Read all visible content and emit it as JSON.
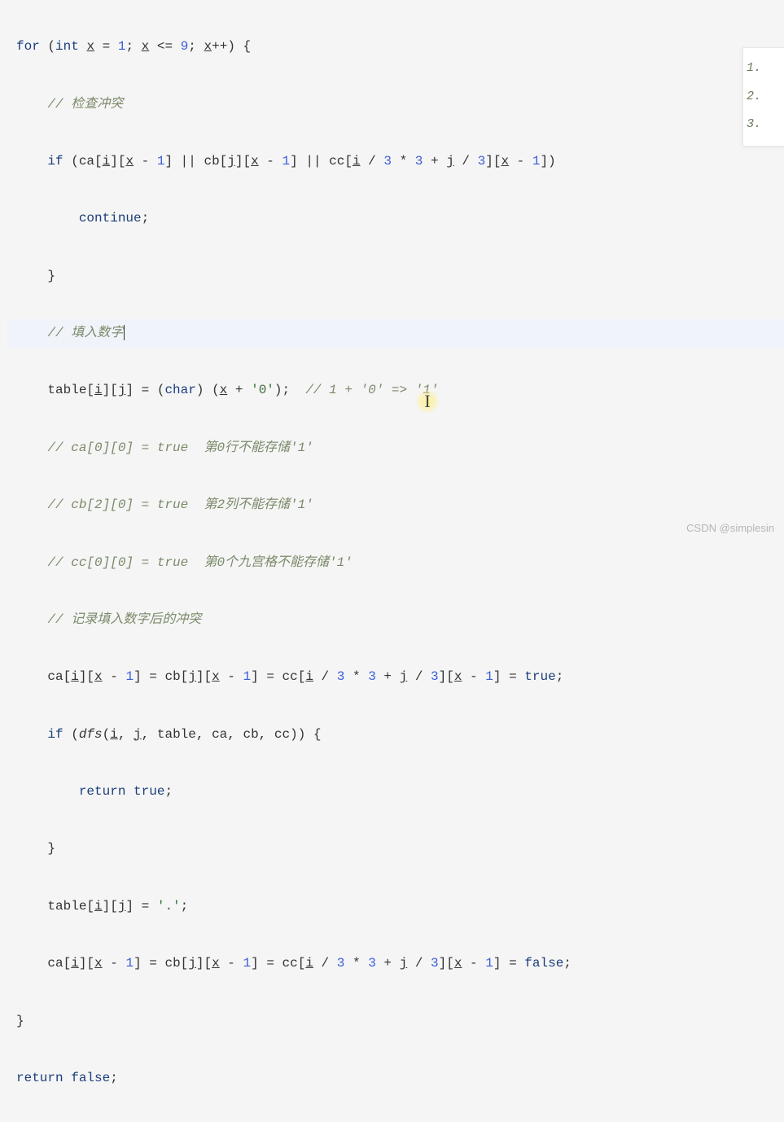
{
  "code": {
    "l1_for": "for",
    "l1_int": "int",
    "l1_x1": "x",
    "l1_eq": " = ",
    "l1_one": "1",
    "l1_sc1": "; ",
    "l1_x2": "x",
    "l1_le": " <= ",
    "l1_nine": "9",
    "l1_sc2": "; ",
    "l1_x3": "x",
    "l1_inc": "++) {",
    "l2_comment": "// 检查冲突",
    "l3_if": "if",
    "l3_a": " (ca[",
    "l3_i1": "i",
    "l3_b": "][",
    "l3_x1": "x",
    "l3_c": " - ",
    "l3_one1": "1",
    "l3_d": "] || cb[",
    "l3_j1": "j",
    "l3_e": "][",
    "l3_x2": "x",
    "l3_f": " - ",
    "l3_one2": "1",
    "l3_g": "] || cc[",
    "l3_i2": "i",
    "l3_h": " / ",
    "l3_three1": "3",
    "l3_i3": " * ",
    "l3_three2": "3",
    "l3_j2": " + ",
    "l3_jvar": "j",
    "l3_k": " / ",
    "l3_three3": "3",
    "l3_l": "][",
    "l3_x3": "x",
    "l3_m": " - ",
    "l3_one3": "1",
    "l3_n": "])",
    "l4_continue": "continue",
    "l4_sc": ";",
    "l5_close": "}",
    "l6_comment": "// 填入数字",
    "l7_a": "table[",
    "l7_i": "i",
    "l7_b": "][",
    "l7_j": "j",
    "l7_c": "] = (",
    "l7_char": "char",
    "l7_d": ") (",
    "l7_x": "x",
    "l7_e": " + ",
    "l7_zero": "'0'",
    "l7_f": ");  ",
    "l7_comment": "// 1 + '0' => '1'",
    "l8_comment": "// ca[0][0] = true  第0行不能存储'1'",
    "l9_comment": "// cb[2][0] = true  第2列不能存储'1'",
    "l10_comment": "// cc[0][0] = true  第0个九宫格不能存储'1'",
    "l11_comment": "// 记录填入数字后的冲突",
    "l12_a": "ca[",
    "l12_i1": "i",
    "l12_b": "][",
    "l12_x1": "x",
    "l12_c": " - ",
    "l12_one1": "1",
    "l12_d": "] = cb[",
    "l12_j1": "j",
    "l12_e": "][",
    "l12_x2": "x",
    "l12_f": " - ",
    "l12_one2": "1",
    "l12_g": "] = cc[",
    "l12_i2": "i",
    "l12_h": " / ",
    "l12_three1": "3",
    "l12_i3": " * ",
    "l12_three2": "3",
    "l12_j2": " + ",
    "l12_jvar": "j",
    "l12_k": " / ",
    "l12_three3": "3",
    "l12_l": "][",
    "l12_x3": "x",
    "l12_m": " - ",
    "l12_one3": "1",
    "l12_n": "] = ",
    "l12_true": "true",
    "l12_sc": ";",
    "l13_if": "if",
    "l13_a": " (",
    "l13_dfs": "dfs",
    "l13_b": "(",
    "l13_i": "i",
    "l13_c": ", ",
    "l13_j": "j",
    "l13_d": ", table, ca, cb, cc)) {",
    "l14_return": "return",
    "l14_sp": " ",
    "l14_true": "true",
    "l14_sc": ";",
    "l15_close": "}",
    "l16_a": "table[",
    "l16_i": "i",
    "l16_b": "][",
    "l16_j": "j",
    "l16_c": "] = ",
    "l16_dot": "'.'",
    "l16_sc": ";",
    "l17_a": "ca[",
    "l17_i1": "i",
    "l17_b": "][",
    "l17_x1": "x",
    "l17_c": " - ",
    "l17_one1": "1",
    "l17_d": "] = cb[",
    "l17_j1": "j",
    "l17_e": "][",
    "l17_x2": "x",
    "l17_f": " - ",
    "l17_one2": "1",
    "l17_g": "] = cc[",
    "l17_i2": "i",
    "l17_h": " / ",
    "l17_three1": "3",
    "l17_i3": " * ",
    "l17_three2": "3",
    "l17_j2": " + ",
    "l17_jvar": "j",
    "l17_k": " / ",
    "l17_three3": "3",
    "l17_l": "][",
    "l17_x3": "x",
    "l17_m": " - ",
    "l17_one3": "1",
    "l17_n": "] = ",
    "l17_false": "false",
    "l17_sc": ";",
    "l18_close": "}",
    "l19_return": "return",
    "l19_sp": " ",
    "l19_false": "false",
    "l19_sc": ";"
  },
  "overlay": {
    "item1": "1.",
    "item2": "2.",
    "item3": "3."
  },
  "watermark": "CSDN @simplesin"
}
